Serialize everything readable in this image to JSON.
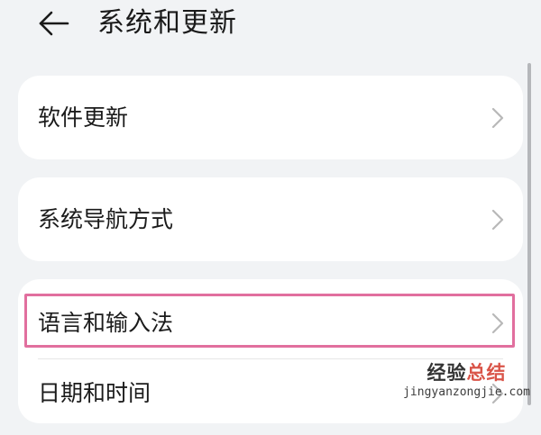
{
  "header": {
    "title": "系统和更新",
    "back_icon": "back-arrow-icon"
  },
  "rows": [
    {
      "label": "软件更新",
      "icon": "chevron-right-icon"
    },
    {
      "label": "系统导航方式",
      "icon": "chevron-right-icon"
    },
    {
      "label": "语言和输入法",
      "icon": "chevron-right-icon"
    },
    {
      "label": "日期和时间",
      "icon": "chevron-right-icon"
    }
  ],
  "highlight": {
    "color": "#e16f9e"
  },
  "watermark": {
    "line1_part1": "经验",
    "line1_part2": "总结",
    "line2": "jingyanzongjie.com"
  },
  "colors": {
    "background": "#f1f3f5",
    "card": "#ffffff",
    "text": "#1b1b1b",
    "chevron": "#b8b8b8"
  }
}
